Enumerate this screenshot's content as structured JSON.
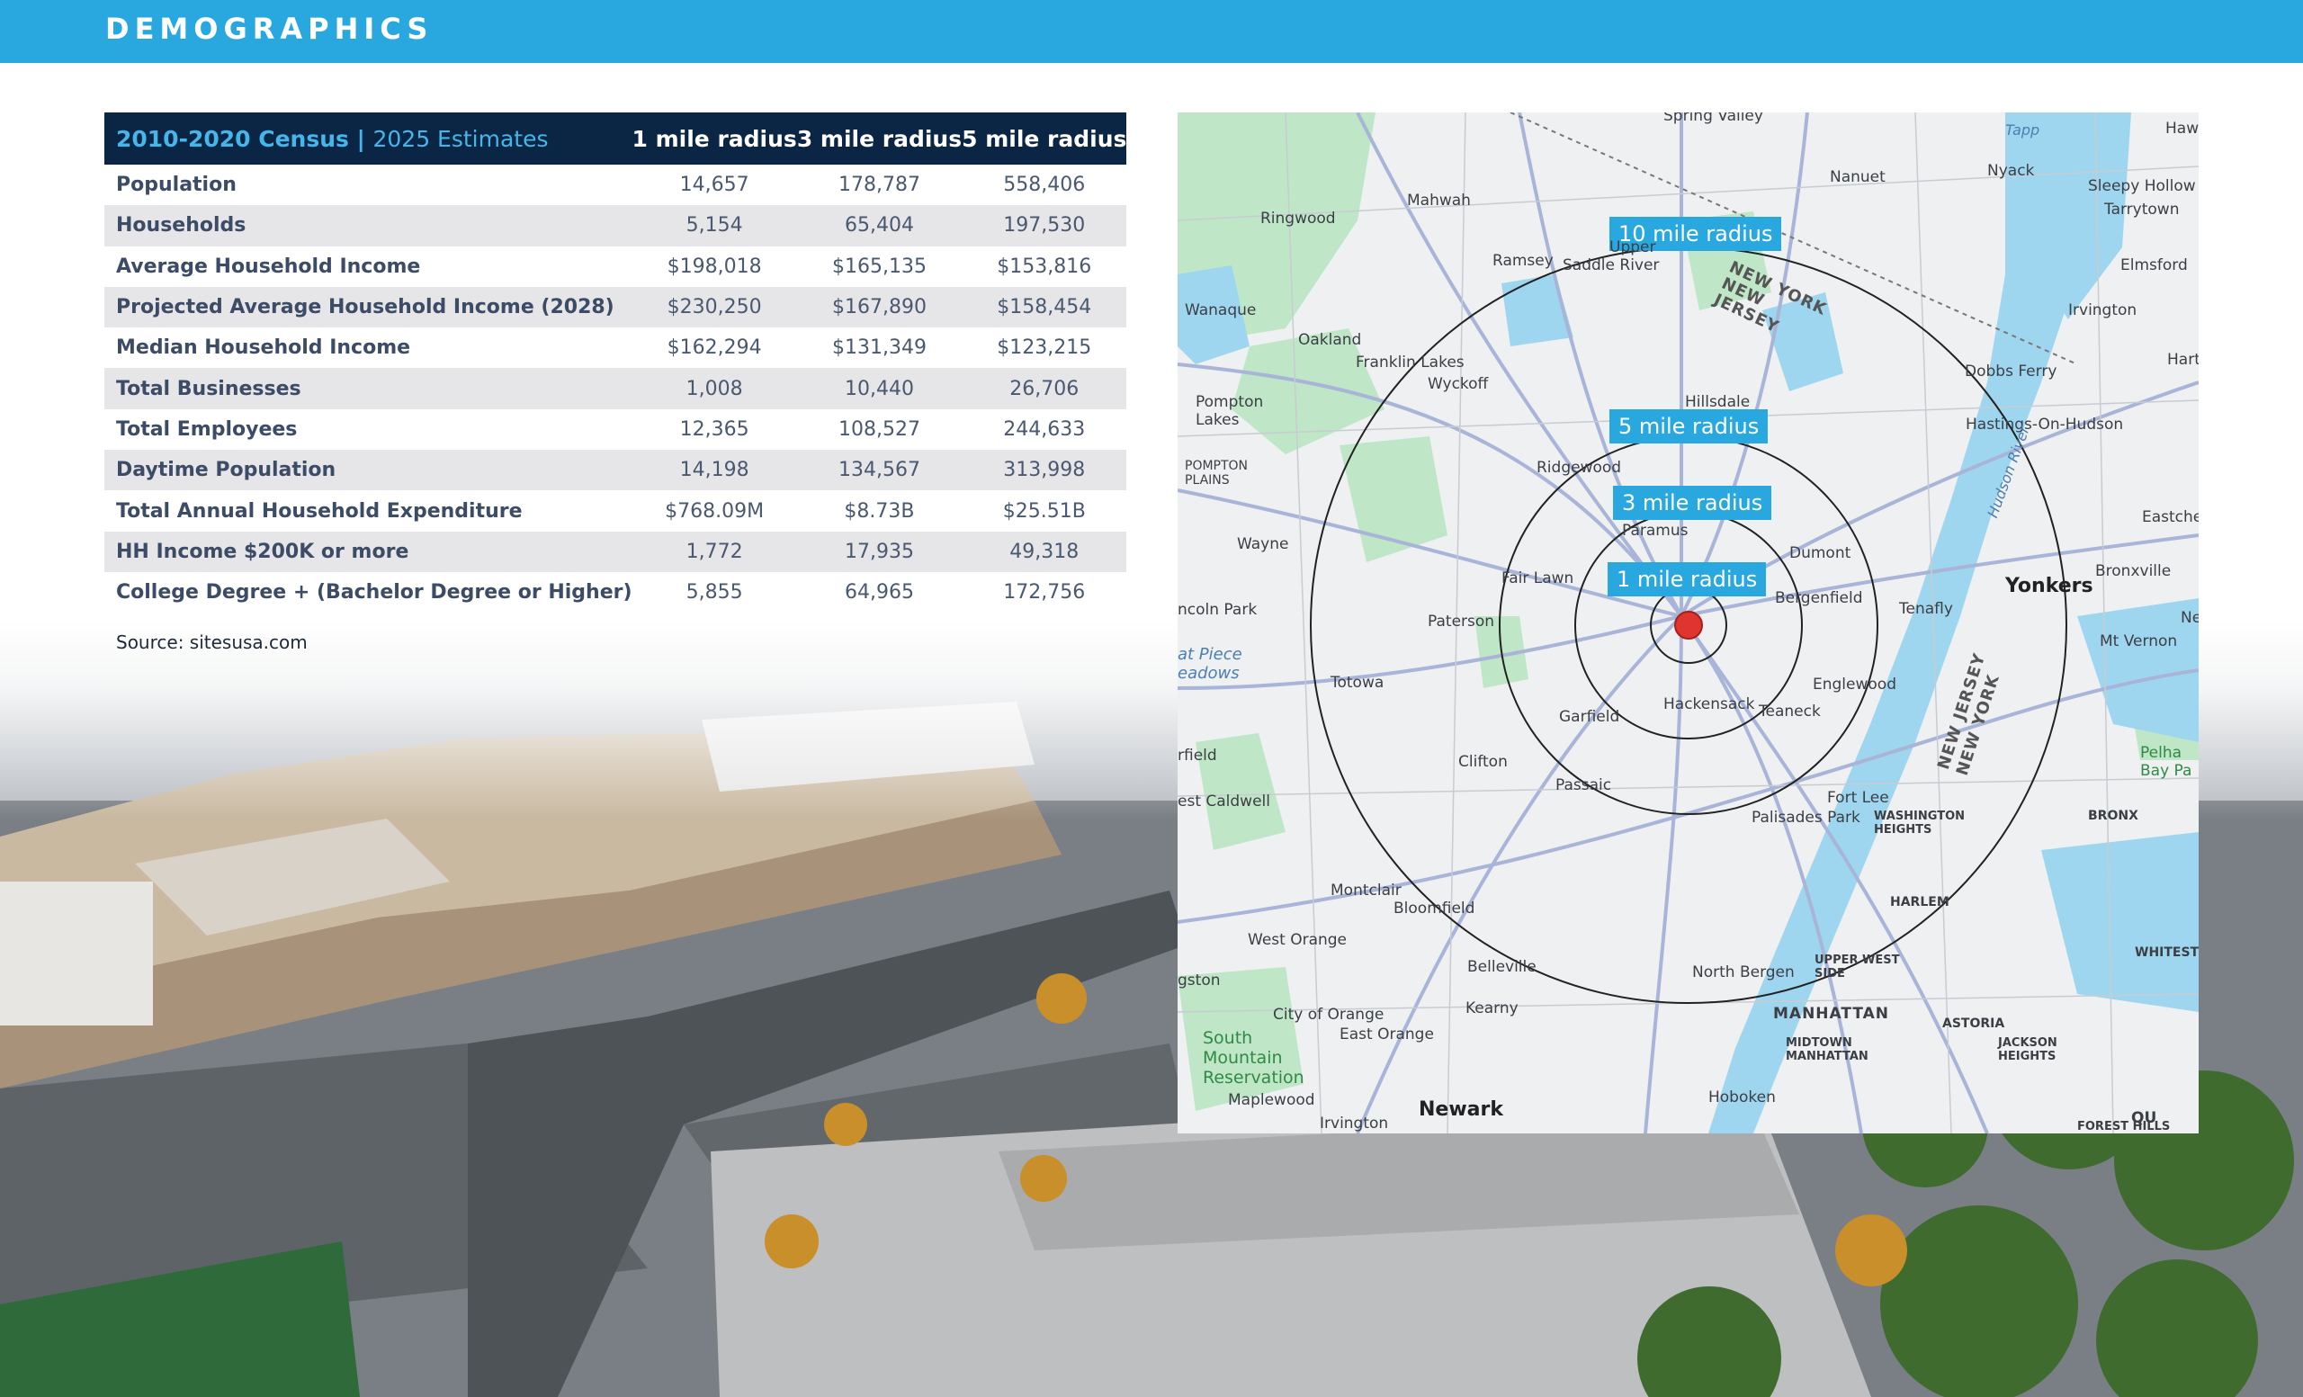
{
  "header": {
    "title": "DEMOGRAPHICS"
  },
  "colors": {
    "header_bg": "#29a8e0",
    "table_head_bg": "#0b2545",
    "accent": "#45b6ea",
    "radius_label_bg": "#29a8e0"
  },
  "table": {
    "header": {
      "census": "2010-2020 Census",
      "separator": "|",
      "estimates": "2025 Estimates"
    },
    "columns": [
      "1 mile radius",
      "3 mile radius",
      "5 mile radius"
    ],
    "rows": [
      {
        "label": "Population",
        "values": [
          "14,657",
          "178,787",
          "558,406"
        ]
      },
      {
        "label": "Households",
        "values": [
          "5,154",
          "65,404",
          "197,530"
        ]
      },
      {
        "label": "Average Household Income",
        "values": [
          "$198,018",
          "$165,135",
          "$153,816"
        ]
      },
      {
        "label": "Projected Average Household Income (2028)",
        "values": [
          "$230,250",
          "$167,890",
          "$158,454"
        ]
      },
      {
        "label": "Median Household Income",
        "values": [
          "$162,294",
          "$131,349",
          "$123,215"
        ]
      },
      {
        "label": "Total Businesses",
        "values": [
          "1,008",
          "10,440",
          "26,706"
        ]
      },
      {
        "label": "Total Employees",
        "values": [
          "12,365",
          "108,527",
          "244,633"
        ]
      },
      {
        "label": "Daytime Population",
        "values": [
          "14,198",
          "134,567",
          "313,998"
        ]
      },
      {
        "label": "Total Annual Household Expenditure",
        "values": [
          "$768.09M",
          "$8.73B",
          "$25.51B"
        ]
      },
      {
        "label": "HH Income $200K or more",
        "values": [
          "1,772",
          "17,935",
          "49,318"
        ]
      },
      {
        "label": "College Degree + (Bachelor Degree or Higher)",
        "values": [
          "5,855",
          "64,965",
          "172,756"
        ]
      }
    ]
  },
  "source": "Source: sitesusa.com",
  "map": {
    "radius_labels": [
      "10 mile radius",
      "5 mile radius",
      "3 mile radius",
      "1 mile radius"
    ],
    "places": {
      "spring_valley": "Spring Valley",
      "nanuet": "Nanuet",
      "nyack": "Nyack",
      "sleepy_hollow": "Sleepy Hollow",
      "tarrytown": "Tarrytown",
      "elmsford": "Elmsford",
      "mahwah": "Mahwah",
      "ringwood": "Ringwood",
      "ramsey": "Ramsey",
      "saddle_river": "Saddle River",
      "upper": "Upper",
      "wanaque": "Wanaque",
      "oakland": "Oakland",
      "franklin_lakes": "Franklin Lakes",
      "wyckoff": "Wyckoff",
      "pompton_lakes": "Pompton Lakes",
      "pompton_plains": "POMPTON PLAINS",
      "hillsdale": "Hillsdale",
      "irvington_ny": "Irvington",
      "dobbs_ferry": "Dobbs Ferry",
      "hastings": "Hastings-On-Hudson",
      "ridgewood": "Ridgewood",
      "paramus": "Paramus",
      "dumont": "Dumont",
      "fair_lawn": "Fair Lawn",
      "bergenfield": "Bergenfield",
      "tenafly": "Tenafly",
      "yonkers": "Yonkers",
      "eastchester": "Eastches",
      "bronxville": "Bronxville",
      "mt_vernon": "Mt Vernon",
      "wayne": "Wayne",
      "lincoln_park": "ncoln Park",
      "paterson": "Paterson",
      "great_piece": "at Piece eadows",
      "totowa": "Totowa",
      "garfield": "Garfield",
      "hackensack": "Hackensack",
      "teaneck": "Teaneck",
      "englewood": "Englewood",
      "fairfield": "rfield",
      "clifton": "Clifton",
      "passaic": "Passaic",
      "fort_lee": "Fort Lee",
      "palisades_park": "Palisades Park",
      "washington_heights": "WASHINGTON HEIGHTS",
      "west_caldwell": "est Caldwell",
      "bronx": "BRONX",
      "pelham_bay": "Pelha Bay Pa",
      "montclair": "Montclair",
      "bloomfield": "Bloomfield",
      "harlem": "HARLEM",
      "west_orange": "West Orange",
      "belleville": "Belleville",
      "north_bergen": "North Bergen",
      "upper_west_side": "UPPER WEST SIDE",
      "whitestone": "WHITEST",
      "livingston": "gston",
      "city_of_orange": "City of Orange",
      "kearny": "Kearny",
      "manhattan": "MANHATTAN",
      "astoria": "ASTORIA",
      "east_orange": "East Orange",
      "midtown": "MIDTOWN MANHATTAN",
      "jackson_heights": "JACKSON HEIGHTS",
      "south_mountain": "South Mountain Reservation",
      "maplewood": "Maplewood",
      "newark": "Newark",
      "hoboken": "Hoboken",
      "irvington_nj": "Irvington",
      "forest_hills": "FOREST HILLS",
      "ny_nj_top": "NEW YORK NEW JERSEY",
      "nj_ny_side": "NEW JERSEY NEW YORK",
      "hudson_river": "Hudson River",
      "tapp": "Tapp",
      "haw": "Haw",
      "hart": "Hart",
      "new": "Ne",
      "qu": "QU"
    }
  }
}
